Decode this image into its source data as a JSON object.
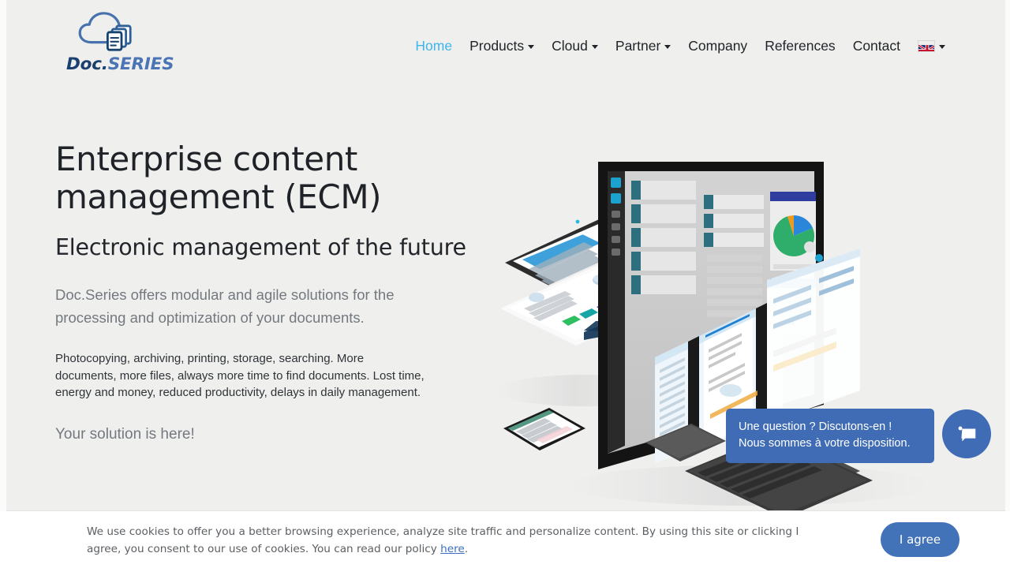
{
  "brand": {
    "name_part1": "Doc.",
    "name_part2": "SERIES",
    "logo_icon": "cloud-documents-icon",
    "accent_color": "#3fb6e9",
    "primary_blue": "#3f6cb5"
  },
  "nav": {
    "items": [
      {
        "label": "Home",
        "active": true,
        "has_dropdown": false
      },
      {
        "label": "Products",
        "active": false,
        "has_dropdown": true
      },
      {
        "label": "Cloud",
        "active": false,
        "has_dropdown": true
      },
      {
        "label": "Partner",
        "active": false,
        "has_dropdown": true
      },
      {
        "label": "Company",
        "active": false,
        "has_dropdown": false
      },
      {
        "label": "References",
        "active": false,
        "has_dropdown": false
      },
      {
        "label": "Contact",
        "active": false,
        "has_dropdown": false
      }
    ],
    "language": {
      "flag": "uk-flag-icon",
      "label": "",
      "has_dropdown": true
    }
  },
  "hero": {
    "title": "Enterprise content management (ECM)",
    "subtitle": "Electronic management of the future",
    "lead": "Doc.Series offers modular and agile solutions for the processing and optimization of your documents.",
    "body": "Photocopying, archiving, printing, storage, searching. More documents, more files, always more time to find documents. Lost time, energy and money, reduced productivity, delays in daily management.",
    "cta_text": "Your solution is here!",
    "artwork": "isometric-devices-mockup"
  },
  "chat": {
    "message_line1": "Une question ? Discutons-en !",
    "message_line2": "Nous sommes à votre disposition.",
    "icon": "chat-bubble-icon",
    "color": "#3f6cb5"
  },
  "cookies": {
    "text_before_link": "We use cookies to offer you a better browsing experience, analyze site traffic and personalize content. By using this site or clicking I agree, you consent to our use of cookies. You can read our policy ",
    "link_label": "here",
    "text_after_link": ".",
    "accept_label": "I agree",
    "accept_color": "#4272b8"
  }
}
